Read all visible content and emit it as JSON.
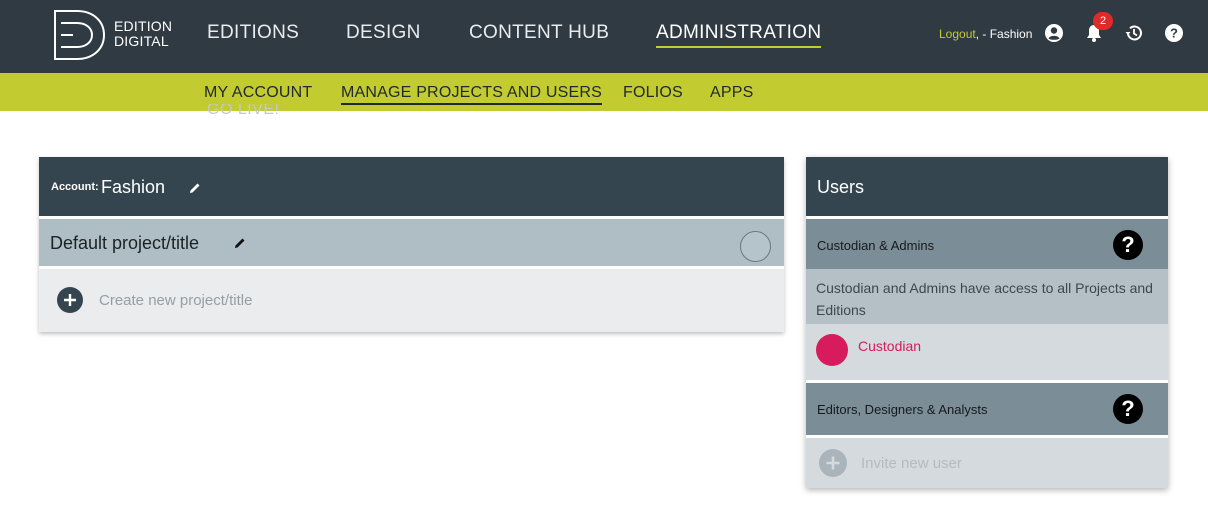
{
  "brand": {
    "line1": "EDITION",
    "line2": "DIGITAL"
  },
  "nav": {
    "editions": "EDITIONS",
    "design": "DESIGN",
    "content_hub": "CONTENT HUB",
    "administration": "ADMINISTRATION"
  },
  "user_bar": {
    "logout_label": "Logout",
    "account_suffix": ", - Fashion",
    "notification_count": "2"
  },
  "subnav": {
    "my_account": "MY ACCOUNT",
    "manage_projects": "MANAGE PROJECTS AND USERS",
    "folios": "FOLIOS",
    "apps": "APPS",
    "ghost_item": "GO LIVE!"
  },
  "account": {
    "label": "Account:",
    "name": "Fashion",
    "project_name": "Default project/title",
    "create_label": "Create new project/title"
  },
  "users": {
    "title": "Users",
    "custodian_section": "Custodian & Admins",
    "custodian_desc": "Custodian and Admins have access to all Projects and Editions",
    "custodian_user": "Custodian",
    "editors_section": "Editors, Designers & Analysts",
    "invite_label": "Invite new user"
  },
  "colors": {
    "topbar": "#2f3a42",
    "accent": "#c2cb30",
    "panel_header": "#35454f",
    "custodian_avatar": "#d81b5c",
    "notification_badge": "#e02a2a"
  },
  "icons": [
    "user-circle-icon",
    "bell-icon",
    "history-icon",
    "help-icon",
    "pencil-icon",
    "plus-circle-icon",
    "question-icon"
  ]
}
